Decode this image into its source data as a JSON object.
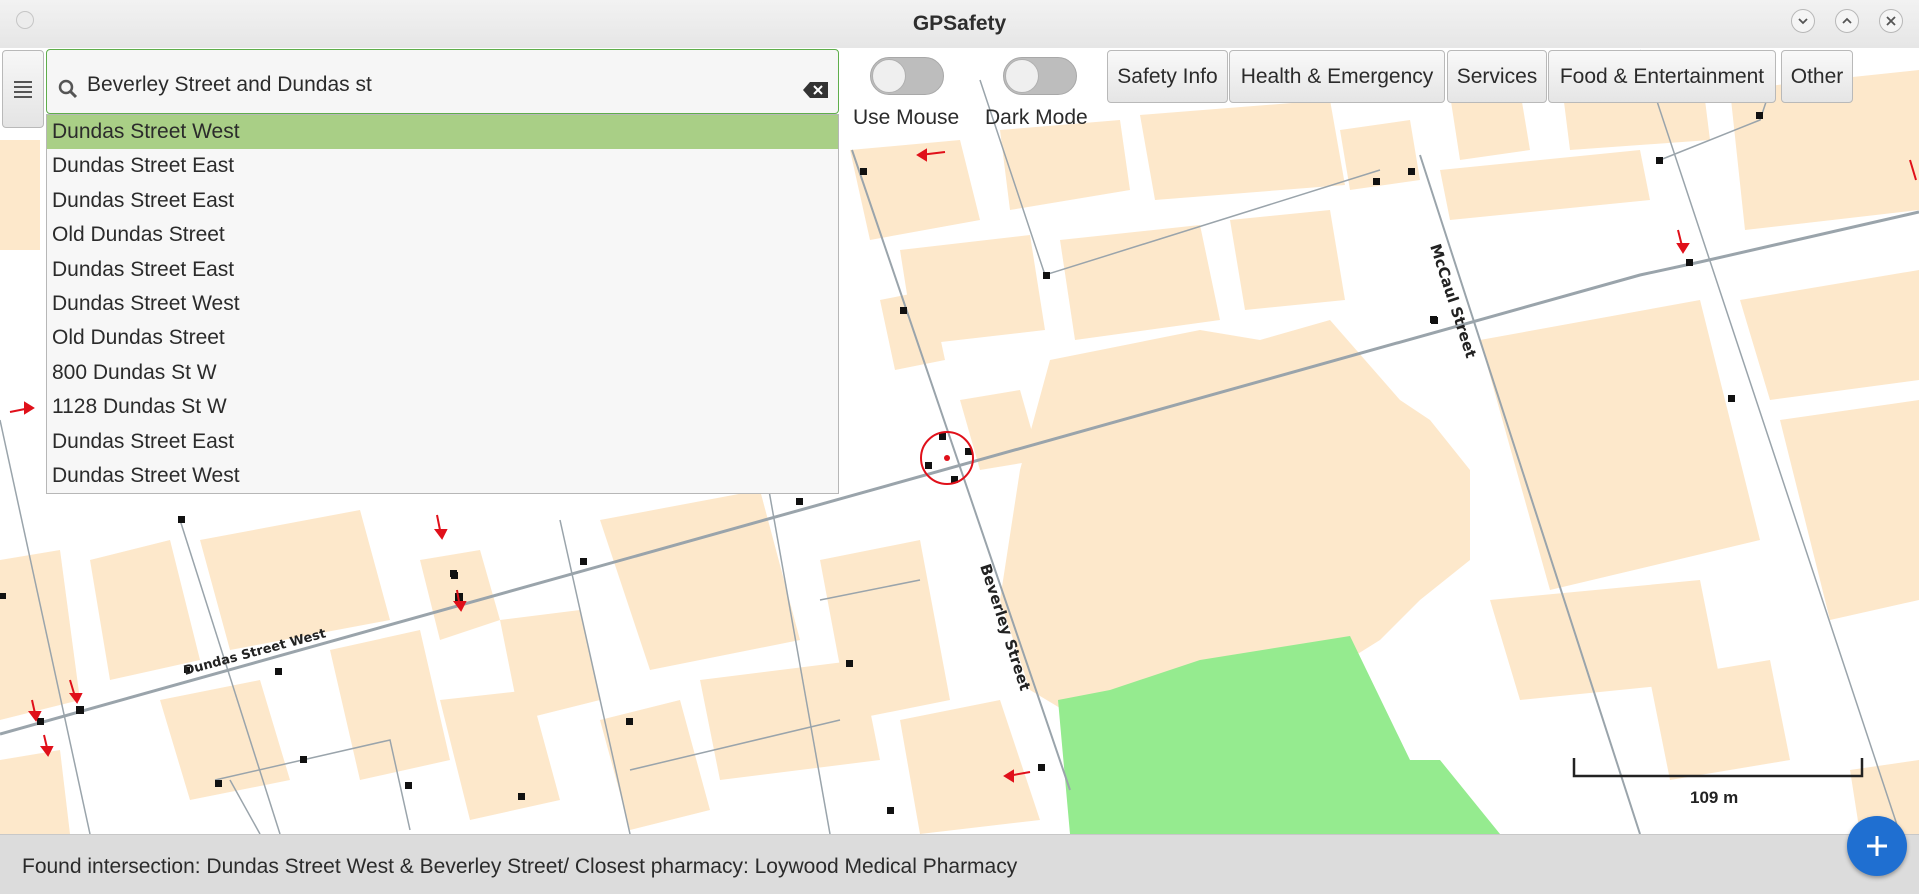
{
  "window": {
    "title": "GPSafety"
  },
  "search": {
    "value": "Beverley Street and Dundas st",
    "suggestions": [
      "Dundas Street West",
      "Dundas Street East",
      "Dundas Street East",
      "Old Dundas Street",
      "Dundas Street East",
      "Dundas Street West",
      "Old Dundas Street",
      "800 Dundas St W",
      "1128 Dundas St W",
      "Dundas Street East",
      "Dundas Street West"
    ],
    "selected_index": 0
  },
  "toggles": {
    "use_mouse": {
      "label": "Use Mouse",
      "on": false
    },
    "dark_mode": {
      "label": "Dark Mode",
      "on": false
    }
  },
  "categories": [
    "Safety Info",
    "Health & Emergency",
    "Services",
    "Food & Entertainment",
    "Other"
  ],
  "map": {
    "street_labels": [
      "McCaul Street",
      "Beverley Street",
      "Dundas Street West"
    ],
    "scale_label": "109 m",
    "colors": {
      "building": "#fde8cb",
      "park": "#95eb8f",
      "road": "#9aa4ab",
      "marker": "#e0101a"
    }
  },
  "status": {
    "text": "Found intersection: Dundas Street West & Beverley Street/ Closest pharmacy: Loywood Medical Pharmacy"
  },
  "icons": {
    "menu": "hamburger-icon",
    "search": "search-icon",
    "clear": "backspace-clear-icon",
    "add": "plus-icon",
    "window_minimize": "chevron-down-icon",
    "window_maximize": "chevron-up-icon",
    "window_close": "close-icon"
  }
}
